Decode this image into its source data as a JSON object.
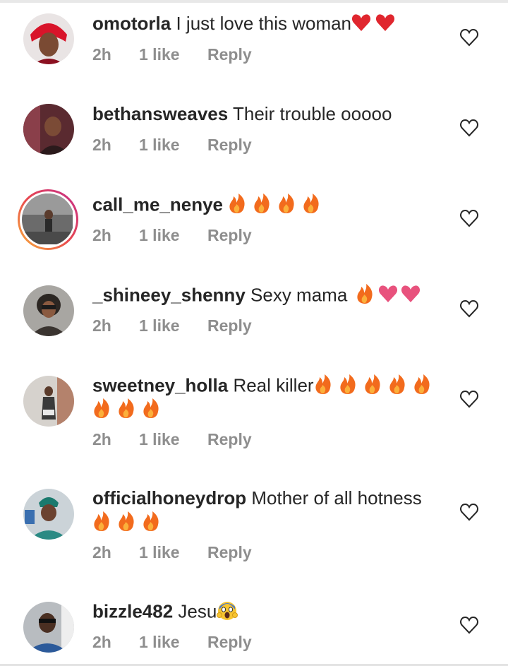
{
  "comments": [
    {
      "username": "omotorla",
      "text": "I just love this woman",
      "emojis": [
        "red-heart",
        "red-heart"
      ],
      "time": "2h",
      "likes": "1 like",
      "reply": "Reply"
    },
    {
      "username": "bethansweaves",
      "text": "Their trouble ooooo",
      "emojis": [],
      "time": "2h",
      "likes": "1 like",
      "reply": "Reply"
    },
    {
      "username": "call_me_nenye",
      "text": "",
      "emojis": [
        "fire",
        "fire",
        "fire",
        "fire"
      ],
      "time": "2h",
      "likes": "1 like",
      "reply": "Reply"
    },
    {
      "username": "_shineey_shenny",
      "text": "Sexy mama",
      "emojis": [
        "fire",
        "pink-heart",
        "pink-heart"
      ],
      "time": "2h",
      "likes": "1 like",
      "reply": "Reply"
    },
    {
      "username": "sweetney_holla",
      "text": "Real killer",
      "emojis": [
        "fire",
        "fire",
        "fire",
        "fire",
        "fire",
        "fire",
        "fire",
        "fire"
      ],
      "time": "2h",
      "likes": "1 like",
      "reply": "Reply"
    },
    {
      "username": "officialhoneydrop",
      "text": "Mother of all hotness",
      "emojis": [
        "fire",
        "fire",
        "fire"
      ],
      "time": "2h",
      "likes": "1 like",
      "reply": "Reply"
    },
    {
      "username": "bizzle482",
      "text": "Jesu",
      "emojis": [
        "screaming-face"
      ],
      "time": "2h",
      "likes": "1 like",
      "reply": "Reply"
    }
  ],
  "colors": {
    "meta_gray": "#8e8e8e",
    "text": "#262626",
    "fire": "#f26b1d",
    "red_heart": "#e0262e",
    "pink_heart": "#e8527d"
  }
}
